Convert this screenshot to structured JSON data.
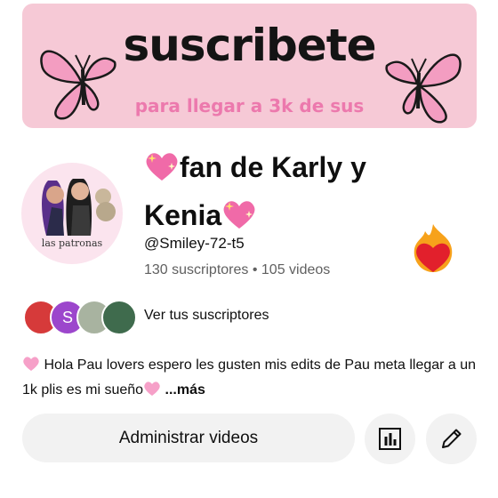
{
  "banner": {
    "title": "suscribete",
    "subtitle": "para llegar a 3k de sus"
  },
  "channel": {
    "name_line1": "fan de Karly y",
    "name_line2": "Kenia",
    "avatar_caption": "las patronas",
    "handle": "@Smiley-72-t5",
    "subscribers": "130 suscriptores",
    "separator": "•",
    "videos": "105 videos"
  },
  "subscribers_row": {
    "avatar_letter": "S",
    "label": "Ver tus suscriptores"
  },
  "description": {
    "text": "Hola Pau lovers espero les gusten mis edits de Pau meta llegar a un 1k plis es mi sueño",
    "more": "...más"
  },
  "actions": {
    "manage_label": "Administrar videos"
  },
  "colors": {
    "banner_bg": "#f6c9d6",
    "banner_sub": "#ec79ad",
    "subscriber_avatar": "#9c46cc",
    "button_bg": "#f2f2f2"
  },
  "icons": [
    "sparkling-heart-icon",
    "fire-heart-icon",
    "analytics-icon",
    "pencil-icon",
    "pink-heart-icon",
    "butterfly-icon"
  ]
}
